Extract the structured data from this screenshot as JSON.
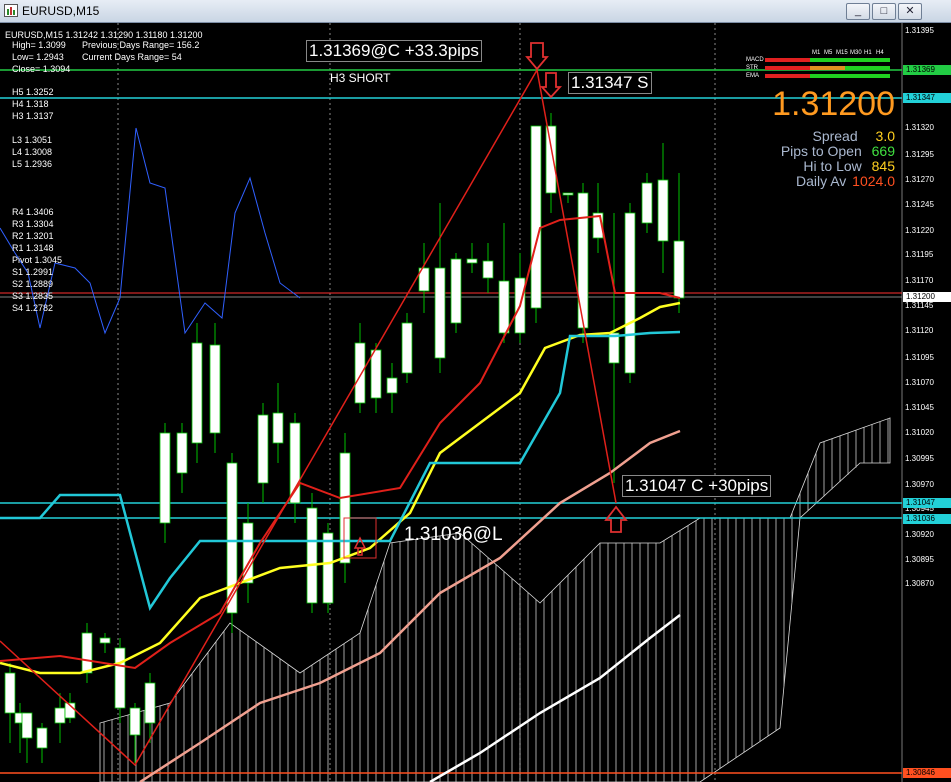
{
  "window": {
    "title": "EURUSD,M15",
    "buttons": {
      "minimize": "_",
      "restore": "□",
      "close": "✕"
    }
  },
  "info": {
    "header": "EURUSD,M15  1.31242 1.31290 1.31180 1.31200",
    "high": "High= 1.3099",
    "prev_range": "Previous Days Range= 156.2",
    "low": "Low= 1.2943",
    "curr_range": "Current Days Range= 54",
    "close": "Close= 1.3094"
  },
  "levels_h": [
    "H5 1.3252",
    "H4 1.318",
    "H3 1.3137"
  ],
  "levels_l": [
    "L3 1.3051",
    "L4 1.3008",
    "L5 1.2936"
  ],
  "levels_r": [
    "R4 1.3406",
    "R3 1.3304",
    "R2 1.3201",
    "R1 1.3148",
    "Pivot 1.3045",
    "S1 1.2991",
    "S2 1.2889",
    "S3 1.2835",
    "S4 1.2782"
  ],
  "annotations": {
    "short_entry": "1.31369@C +33.3pips",
    "h3_short": "H3 SHORT",
    "s_level": "1.31347 S",
    "close_label": "1.31047 C +30pips",
    "long_entry": "1.31036@L"
  },
  "stats": {
    "price": "1.31200",
    "spread_label": "Spread",
    "spread_value": "3.0",
    "pips_label": "Pips to Open",
    "pips_value": "669",
    "hilo_label": "Hi to Low",
    "hilo_value": "845",
    "daily_label": "Daily Av",
    "daily_value": "1024.0"
  },
  "indicator_table": {
    "timeframes": [
      "M1",
      "M5",
      "M15",
      "M30",
      "H1",
      "H4"
    ],
    "rows": [
      "MACD",
      "STR",
      "EMA"
    ]
  },
  "axis": {
    "ticks": [
      "1.31395",
      "1.31320",
      "1.31295",
      "1.31270",
      "1.31245",
      "1.31220",
      "1.31195",
      "1.31170",
      "1.31145",
      "1.31120",
      "1.31095",
      "1.31070",
      "1.31045",
      "1.31020",
      "1.30995",
      "1.30970",
      "1.30945",
      "1.30920",
      "1.30895",
      "1.30870"
    ],
    "tags": [
      {
        "label": "1.31369",
        "color": "#22cc44"
      },
      {
        "label": "1.31347",
        "color": "#22d0d8"
      },
      {
        "label": "1.31200",
        "color": "#ffffff"
      },
      {
        "label": "1.31047",
        "color": "#22d0d8"
      },
      {
        "label": "1.31036",
        "color": "#22d0d8"
      },
      {
        "label": "1.30846",
        "color": "#ff5020"
      }
    ]
  },
  "colors": {
    "up_candle": "#ffffff",
    "wick": "#00c000",
    "tenkan": "#22c8d8",
    "kijun": "#e0201a",
    "ema_yellow": "#ffff20",
    "ema_salmon": "#f0a090",
    "ema_white": "#ffffff",
    "levels_blue": "#3060ff"
  }
}
